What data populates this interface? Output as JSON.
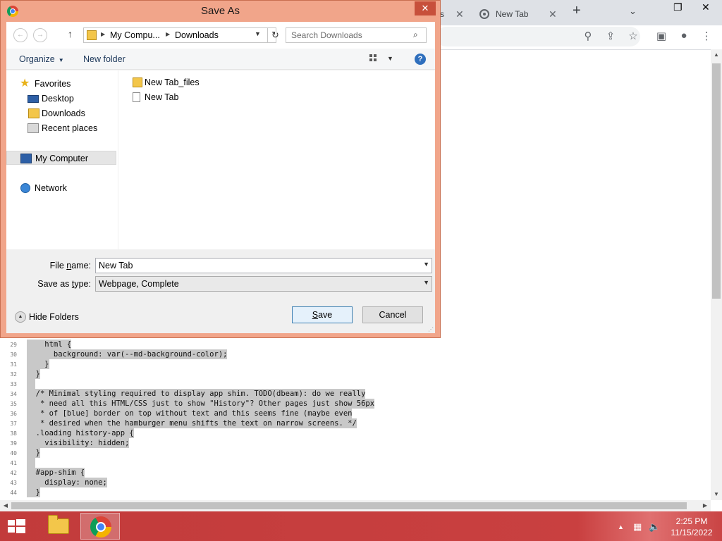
{
  "browser": {
    "partial_tab_text": "s",
    "active_tab_title": "New Tab"
  },
  "source_lines": [
    {
      "num": "29",
      "text": "    html {"
    },
    {
      "num": "30",
      "text": "      background: var(--md-background-color);"
    },
    {
      "num": "31",
      "text": "    }"
    },
    {
      "num": "32",
      "text": "  }"
    },
    {
      "num": "33",
      "text": ""
    },
    {
      "num": "34",
      "text": "  /* Minimal styling required to display app shim. TODO(dbeam): do we really"
    },
    {
      "num": "35",
      "text": "   * need all this HTML/CSS just to show \"History\"? Other pages just show 56px"
    },
    {
      "num": "36",
      "text": "   * of [blue] border on top without text and this seems fine (maybe even"
    },
    {
      "num": "37",
      "text": "   * desired when the hamburger menu shifts the text on narrow screens. */"
    },
    {
      "num": "38",
      "text": "  .loading history-app {"
    },
    {
      "num": "39",
      "text": "    visibility: hidden;"
    },
    {
      "num": "40",
      "text": "  }"
    },
    {
      "num": "41",
      "text": ""
    },
    {
      "num": "42",
      "text": "  #app-shim {"
    },
    {
      "num": "43",
      "text": "    display: none;"
    },
    {
      "num": "44",
      "text": "  }"
    }
  ],
  "dialog": {
    "title": "Save As",
    "address": {
      "crumb1": "My Compu...",
      "crumb2": "Downloads"
    },
    "search_placeholder": "Search Downloads",
    "organize_label": "Organize",
    "new_folder_label": "New folder",
    "nav": {
      "favorites": "Favorites",
      "desktop": "Desktop",
      "downloads": "Downloads",
      "recent": "Recent places",
      "my_computer": "My Computer",
      "network": "Network"
    },
    "files": [
      {
        "name": "New Tab_files"
      },
      {
        "name": "New Tab"
      }
    ],
    "file_name_label_pre": "File ",
    "file_name_label_u": "n",
    "file_name_label_post": "ame:",
    "file_name_value": "New Tab",
    "save_type_label_pre": "Save as ",
    "save_type_label_u": "t",
    "save_type_label_post": "ype:",
    "save_type_value": "Webpage, Complete",
    "hide_folders_label": "Hide Folders",
    "save_button_u": "S",
    "save_button_rest": "ave",
    "cancel_button": "Cancel"
  },
  "taskbar": {
    "time": "2:25 PM",
    "date": "11/15/2022"
  },
  "colors": {
    "taskbar": "#c94040",
    "dialog_frame": "#f1a58a",
    "close_button": "#c7503b"
  }
}
